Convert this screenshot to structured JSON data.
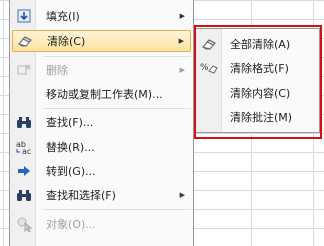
{
  "menu": {
    "items": [
      {
        "label": "填充(I)",
        "has_submenu": true,
        "enabled": true,
        "selected": false,
        "icon": "fill-down-icon"
      },
      {
        "label": "清除(C)",
        "has_submenu": true,
        "enabled": true,
        "selected": true,
        "icon": "eraser-icon"
      },
      {
        "label": "删除",
        "has_submenu": true,
        "enabled": false,
        "selected": false,
        "icon": "delete-cells-icon"
      },
      {
        "label": "移动或复制工作表(M)...",
        "has_submenu": false,
        "enabled": true,
        "selected": false,
        "icon": ""
      },
      {
        "label": "查找(F)...",
        "has_submenu": false,
        "enabled": true,
        "selected": false,
        "icon": "binoculars-icon"
      },
      {
        "label": "替换(R)...",
        "has_submenu": false,
        "enabled": true,
        "selected": false,
        "icon": "replace-icon"
      },
      {
        "label": "转到(G)...",
        "has_submenu": false,
        "enabled": true,
        "selected": false,
        "icon": "goto-arrow-icon"
      },
      {
        "label": "查找和选择(F)",
        "has_submenu": true,
        "enabled": true,
        "selected": false,
        "icon": "binoculars-icon"
      },
      {
        "label": "对象(O)...",
        "has_submenu": false,
        "enabled": false,
        "selected": false,
        "icon": "select-objects-icon"
      }
    ]
  },
  "submenu": {
    "items": [
      {
        "label": "全部清除(A)",
        "icon": "eraser-icon"
      },
      {
        "label": "清除格式(F)",
        "icon": "clear-format-icon"
      },
      {
        "label": "清除内容(C)",
        "icon": ""
      },
      {
        "label": "清除批注(M)",
        "icon": ""
      }
    ]
  },
  "colors": {
    "highlight_frame": "#d40f17",
    "selected_item": "#fbe3a0"
  }
}
